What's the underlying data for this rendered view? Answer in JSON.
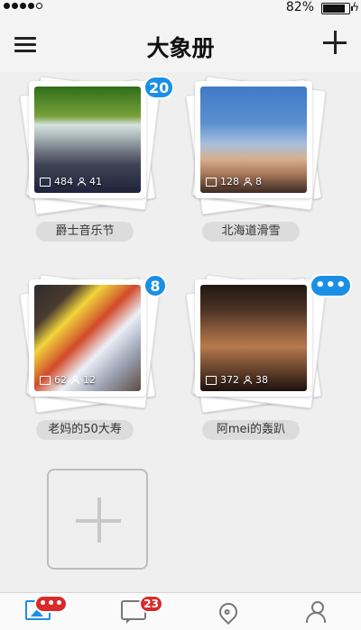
{
  "status_bar": {
    "battery_text": "82%",
    "signal_dots": 5,
    "signal_filled": 4
  },
  "nav": {
    "title": "大象册",
    "menu_icon": "menu-icon",
    "add_icon": "plus-icon"
  },
  "albums": [
    {
      "name": "爵士音乐节",
      "photos": "484",
      "people": "41",
      "badge": "20",
      "badge_type": "count"
    },
    {
      "name": "北海道滑雪",
      "photos": "128",
      "people": "8",
      "badge": "",
      "badge_type": "none"
    },
    {
      "name": "老妈的50大寿",
      "photos": "62",
      "people": "12",
      "badge": "8",
      "badge_type": "count"
    },
    {
      "name": "阿mei的轰趴",
      "photos": "372",
      "people": "38",
      "badge": "•••",
      "badge_type": "more"
    }
  ],
  "tabbar": {
    "items": [
      {
        "icon": "photos-icon",
        "badge": "•••"
      },
      {
        "icon": "chat-icon",
        "badge": "23"
      },
      {
        "icon": "location-icon",
        "badge": ""
      },
      {
        "icon": "profile-icon",
        "badge": ""
      }
    ],
    "active_color": "#1a8fe6",
    "badge_color": "#d92a2a"
  },
  "colors": {
    "accent": "#1a8fe6",
    "background": "#efefef"
  }
}
